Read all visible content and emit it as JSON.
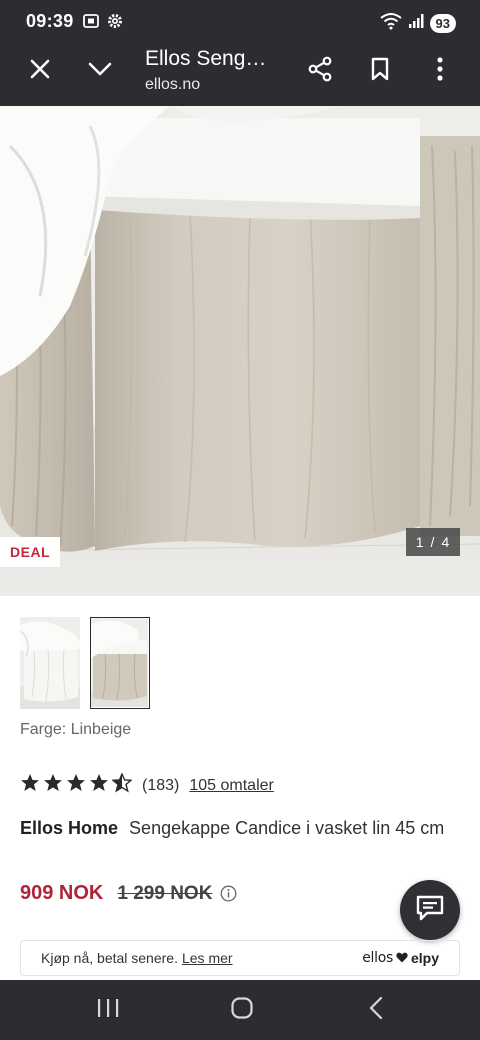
{
  "status_bar": {
    "time": "09:39",
    "battery": "93",
    "icons": [
      "screenshot-icon",
      "gear-icon",
      "wifi-icon",
      "signal-icon",
      "battery-icon"
    ]
  },
  "toolbar": {
    "title": "Ellos Seng…",
    "url": "ellos.no",
    "icons": [
      "close-icon",
      "chevron-down-icon",
      "share-icon",
      "bookmark-icon",
      "more-vert-icon"
    ]
  },
  "gallery": {
    "badge": "DEAL",
    "current": "1",
    "separator": "/",
    "total": "4"
  },
  "product": {
    "color_label": "Farge: Linbeige",
    "rating": {
      "value_stars": 4.5,
      "count": "(183)",
      "reviews_link": "105 omtaler"
    },
    "brand": "Ellos Home",
    "name": "Sengekappe Candice i vasket lin 45 cm",
    "price": "909 NOK",
    "old_price": "1 299 NOK"
  },
  "bnpl": {
    "text": "Kjøp nå, betal senere.",
    "link": "Les mer",
    "logo_ellos": "ellos",
    "logo_elpy": "elpy"
  },
  "colors": {
    "chrome": "#2b2d31",
    "price_red": "#b0243a",
    "deal_red": "#c2283a",
    "linen": "#cfc9bd"
  }
}
